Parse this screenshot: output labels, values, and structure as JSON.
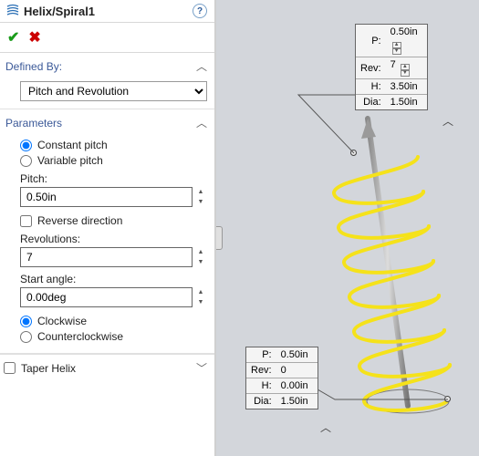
{
  "title": "Helix/Spiral1",
  "defined_by": {
    "label": "Defined By:",
    "value": "Pitch and Revolution"
  },
  "parameters": {
    "label": "Parameters",
    "pitch_mode": {
      "constant": "Constant pitch",
      "variable": "Variable pitch",
      "selected": "constant"
    },
    "pitch": {
      "label": "Pitch:",
      "value": "0.50in"
    },
    "reverse": {
      "label": "Reverse direction",
      "checked": false
    },
    "revolutions": {
      "label": "Revolutions:",
      "value": "7"
    },
    "start_angle": {
      "label": "Start angle:",
      "value": "0.00deg"
    },
    "direction": {
      "cw": "Clockwise",
      "ccw": "Counterclockwise",
      "selected": "cw"
    }
  },
  "taper": {
    "label": "Taper Helix",
    "checked": false
  },
  "callouts": {
    "top": {
      "P": "0.50in",
      "Rev": "7",
      "H": "3.50in",
      "Dia": "1.50in"
    },
    "bottom": {
      "P": "0.50in",
      "Rev": "0",
      "H": "0.00in",
      "Dia": "1.50in"
    }
  },
  "keys": {
    "P": "P:",
    "Rev": "Rev:",
    "H": "H:",
    "Dia": "Dia:"
  }
}
